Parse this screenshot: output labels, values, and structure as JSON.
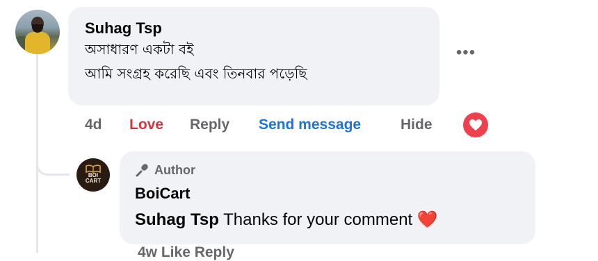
{
  "comment": {
    "author": "Suhag Tsp",
    "lines": [
      "অসাধারণ একটা বই",
      "আমি সংগ্রহ করেছি এবং তিনবার পড়েছি"
    ],
    "more_label": "•••",
    "actions": {
      "time": "4d",
      "love": "Love",
      "reply": "Reply",
      "send_message": "Send message",
      "hide": "Hide"
    },
    "reaction_icon": "heart-icon",
    "reaction_color": "#f0404d"
  },
  "reply": {
    "badge": "Author",
    "badge_icon": "microphone-icon",
    "author": "BoiCart",
    "avatar_text_line1": "BOI",
    "avatar_text_line2": "CART",
    "mention": "Suhag Tsp",
    "text": " Thanks for your comment ",
    "emoji": "❤️",
    "next_actions_partial": "4w    Like    Reply"
  },
  "colors": {
    "bubble": "#f0f2f5",
    "love": "#d9333f",
    "link": "#1b74e4",
    "muted": "#65676b"
  }
}
